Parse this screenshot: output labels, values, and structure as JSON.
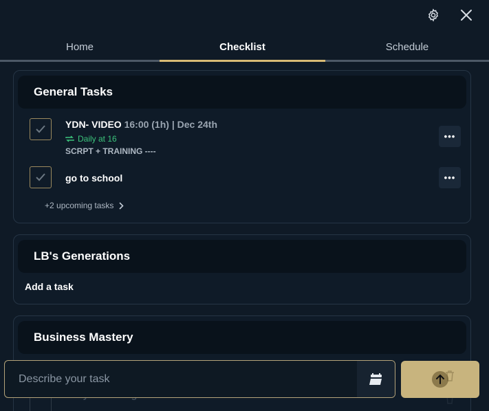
{
  "topbar": {
    "settings_icon": "gear-icon",
    "close_icon": "close-icon"
  },
  "tabs": [
    {
      "label": "Home",
      "active": false
    },
    {
      "label": "Checklist",
      "active": true
    },
    {
      "label": "Schedule",
      "active": false
    }
  ],
  "sections": {
    "general": {
      "title": "General Tasks",
      "tasks": [
        {
          "title": "YDN- VIDEO",
          "meta": "16:00 (1h) | Dec 24th",
          "recurrence": "Daily at 16",
          "description": "SCRPT + TRAINING ----",
          "more_label": "•••"
        },
        {
          "title": "go to school",
          "more_label": "•••"
        }
      ],
      "upcoming": "+2 upcoming tasks"
    },
    "lb": {
      "title": "LB's Generations",
      "add_task": "Add a task"
    },
    "business": {
      "title": "Business Mastery",
      "partial_task": "Daily marketing task"
    }
  },
  "composer": {
    "placeholder": "Describe your task",
    "calendar_icon": "calendar-icon",
    "send_icon": "arrow-up-icon"
  },
  "colors": {
    "background": "#0f1a26",
    "accent": "#d9bb75",
    "recurrence": "#3cc47c"
  }
}
